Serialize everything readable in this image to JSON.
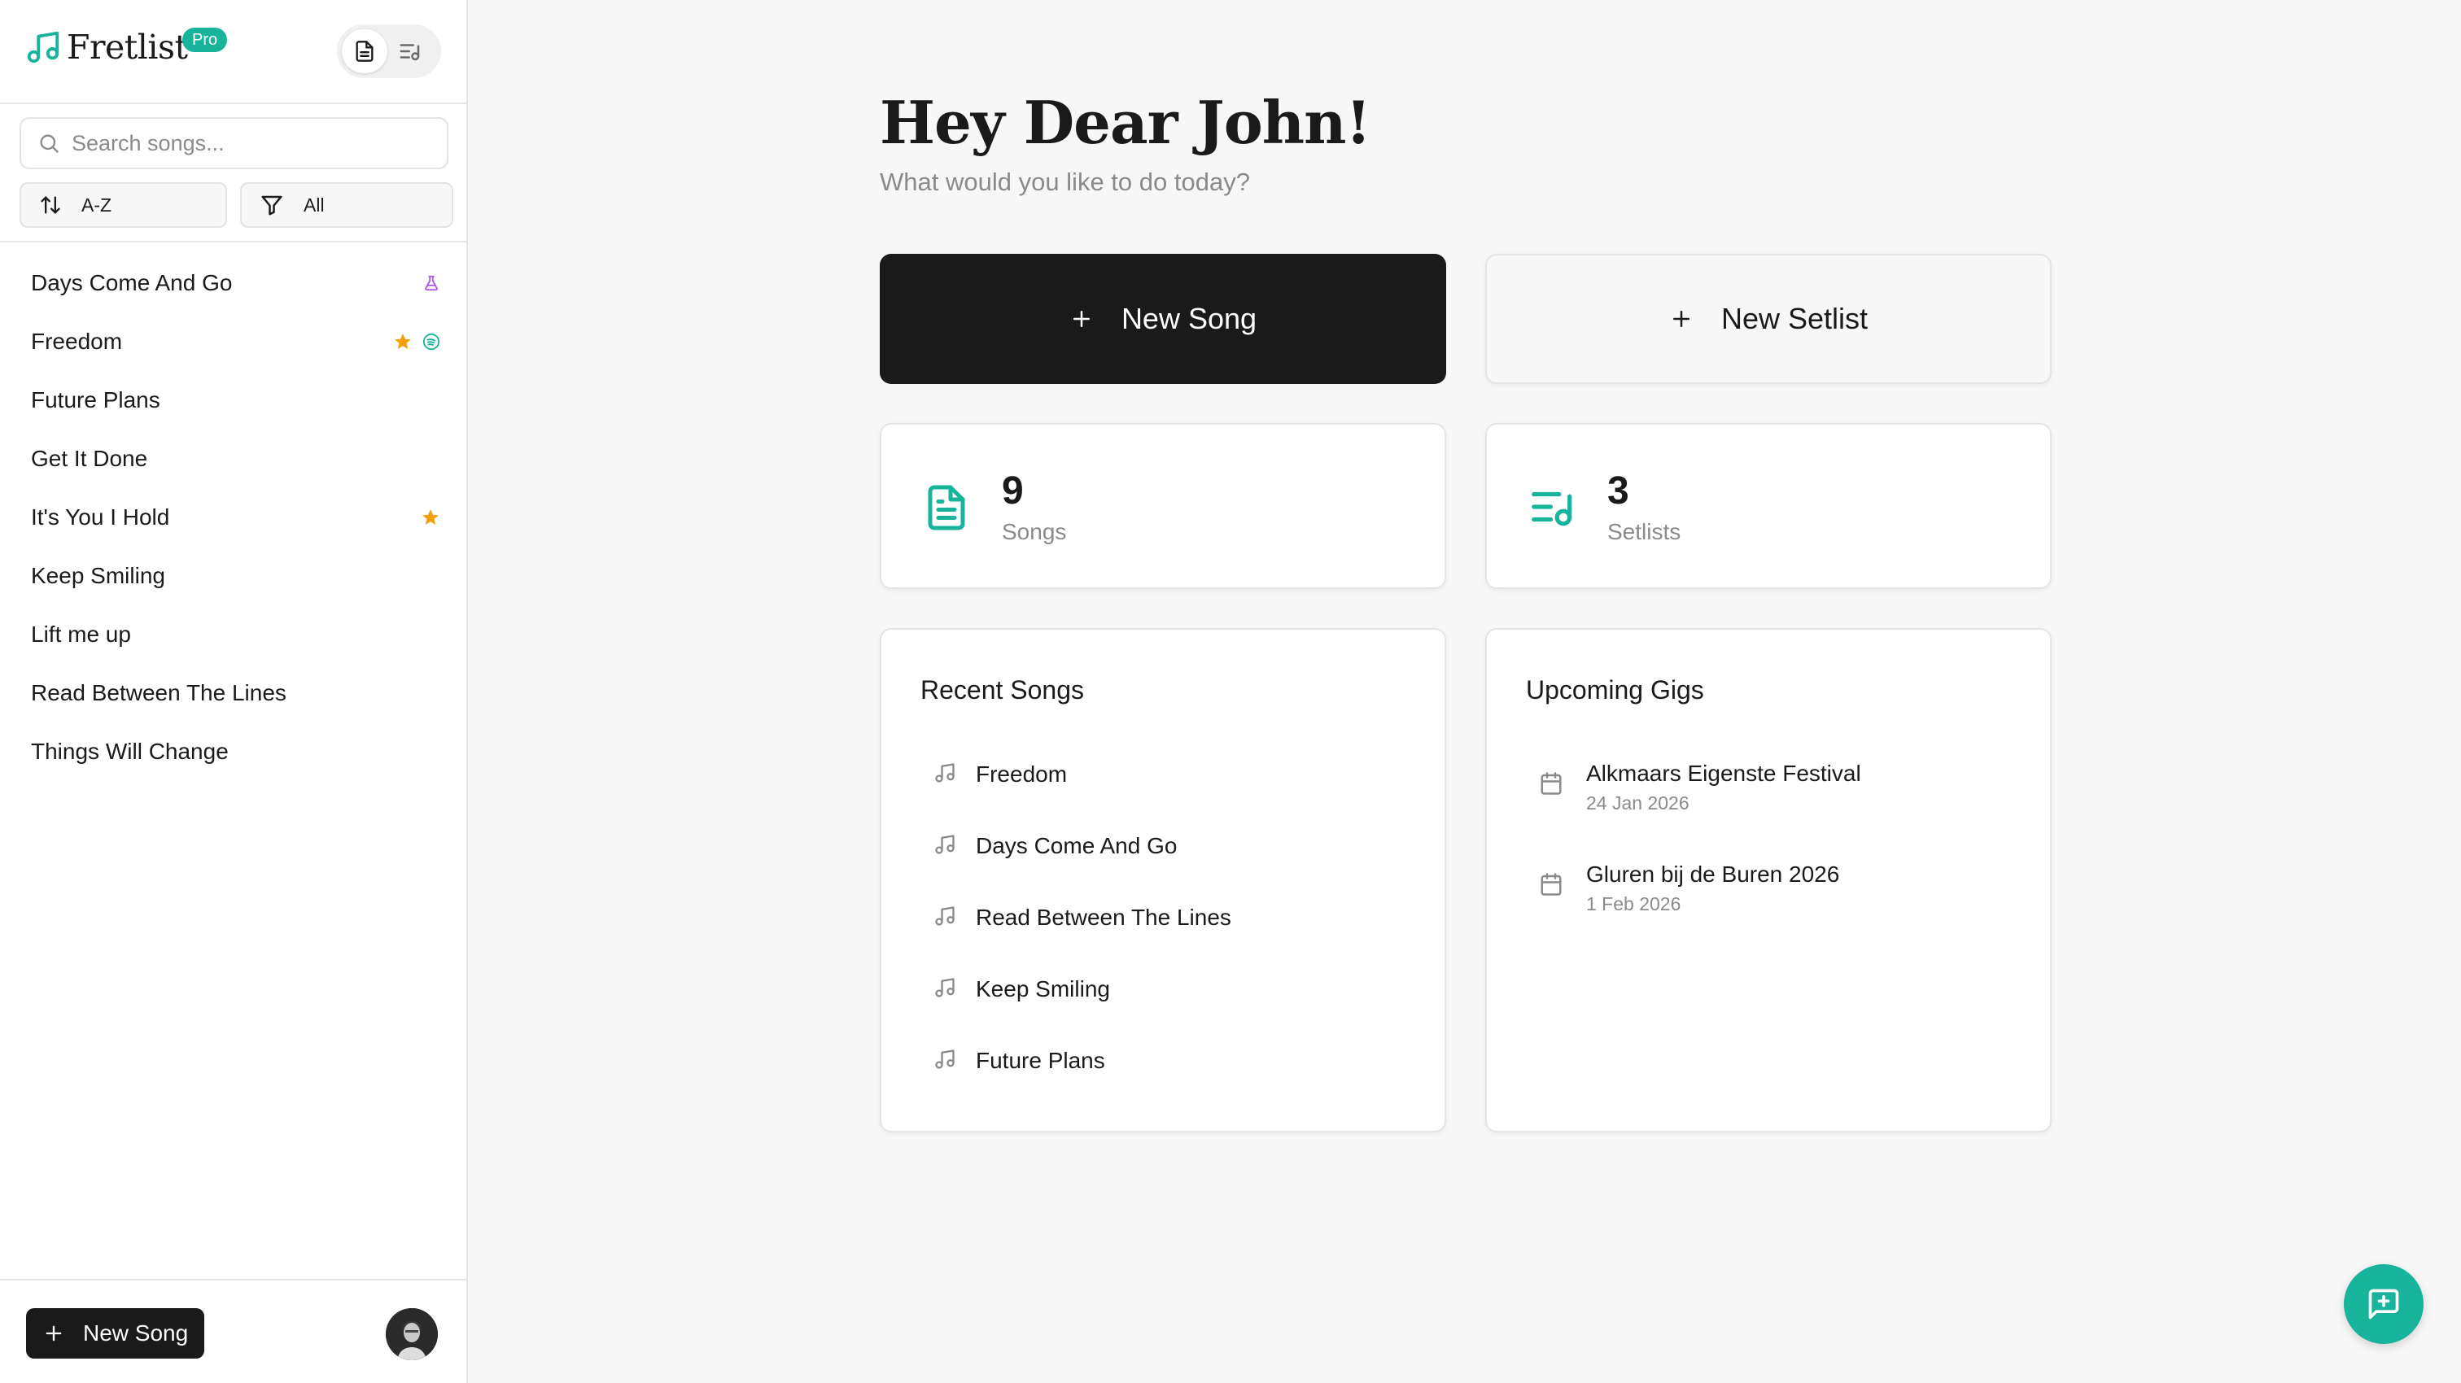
{
  "app": {
    "name": "Fretlist",
    "badge": "Pro",
    "accent_color": "#18b39b"
  },
  "sidebar": {
    "search_placeholder": "Search songs...",
    "sort_label": "A-Z",
    "filter_label": "All",
    "songs": [
      {
        "title": "Days Come And Go",
        "icons": [
          "flask-icon"
        ]
      },
      {
        "title": "Freedom",
        "icons": [
          "star-icon",
          "spotify-icon"
        ]
      },
      {
        "title": "Future Plans",
        "icons": []
      },
      {
        "title": "Get It Done",
        "icons": []
      },
      {
        "title": "It's You I Hold",
        "icons": [
          "star-icon"
        ]
      },
      {
        "title": "Keep Smiling",
        "icons": []
      },
      {
        "title": "Lift me up",
        "icons": []
      },
      {
        "title": "Read Between The Lines",
        "icons": []
      },
      {
        "title": "Things Will Change",
        "icons": []
      }
    ],
    "new_song_label": "New Song"
  },
  "main": {
    "greeting": "Hey Dear John!",
    "subtitle": "What would you like to do today?",
    "new_song_label": "New Song",
    "new_setlist_label": "New Setlist",
    "stats": {
      "songs_count": "9",
      "songs_label": "Songs",
      "setlists_count": "3",
      "setlists_label": "Setlists"
    },
    "recent_songs": {
      "title": "Recent Songs",
      "items": [
        "Freedom",
        "Days Come And Go",
        "Read Between The Lines",
        "Keep Smiling",
        "Future Plans"
      ]
    },
    "upcoming_gigs": {
      "title": "Upcoming Gigs",
      "items": [
        {
          "name": "Alkmaars Eigenste Festival",
          "date": "24 Jan 2026"
        },
        {
          "name": "Gluren bij de Buren 2026",
          "date": "1 Feb 2026"
        }
      ]
    }
  }
}
